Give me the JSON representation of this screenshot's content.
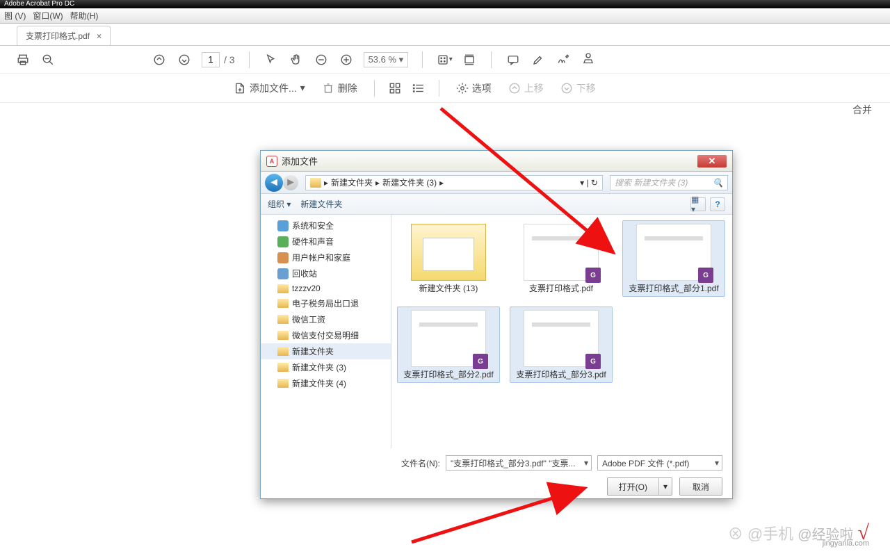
{
  "app": {
    "title": "Adobe Acrobat Pro DC"
  },
  "menu": {
    "view": "图 (V)",
    "window": "窗口(W)",
    "help": "帮助(H)"
  },
  "tab": {
    "name": "支票打印格式.pdf"
  },
  "toolbar1": {
    "page_current": "1",
    "page_total": "/ 3",
    "zoom": "53.6 %"
  },
  "toolbar2": {
    "add_file": "添加文件...",
    "delete": "删除",
    "options": "选项",
    "move_up": "上移",
    "move_down": "下移",
    "merge": "合并"
  },
  "dialog": {
    "title": "添加文件",
    "crumb": [
      "新建文件夹",
      "新建文件夹 (3)"
    ],
    "search_placeholder": "搜索 新建文件夹 (3)",
    "organize": "组织 ▾",
    "new_folder": "新建文件夹",
    "tree": [
      {
        "label": "系统和安全",
        "icon": "shield"
      },
      {
        "label": "硬件和声音",
        "icon": "sound"
      },
      {
        "label": "用户帐户和家庭",
        "icon": "user"
      },
      {
        "label": "回收站",
        "icon": "bin"
      },
      {
        "label": "tzzzv20",
        "icon": "folder"
      },
      {
        "label": "电子税务局出口退",
        "icon": "folder"
      },
      {
        "label": "微信工资",
        "icon": "folder"
      },
      {
        "label": "微信支付交易明细",
        "icon": "folder"
      },
      {
        "label": "新建文件夹",
        "icon": "folder",
        "sel": true
      },
      {
        "label": "新建文件夹 (3)",
        "icon": "folder"
      },
      {
        "label": "新建文件夹 (4)",
        "icon": "folder"
      }
    ],
    "files": [
      {
        "name": "新建文件夹 (13)",
        "type": "folder"
      },
      {
        "name": "支票打印格式.pdf",
        "type": "pdf"
      },
      {
        "name": "支票打印格式_部分1.pdf",
        "type": "pdf",
        "sel": true
      },
      {
        "name": "支票打印格式_部分2.pdf",
        "type": "pdf",
        "sel": true
      },
      {
        "name": "支票打印格式_部分3.pdf",
        "type": "pdf",
        "sel": true
      }
    ],
    "filename_label": "文件名(N):",
    "filename_value": "\"支票打印格式_部分3.pdf\" \"支票...",
    "filter": "Adobe PDF 文件 (*.pdf)",
    "open": "打开(O)",
    "cancel": "取消"
  },
  "watermark": {
    "text": "@经验啦",
    "site": "jingyanla.com"
  }
}
